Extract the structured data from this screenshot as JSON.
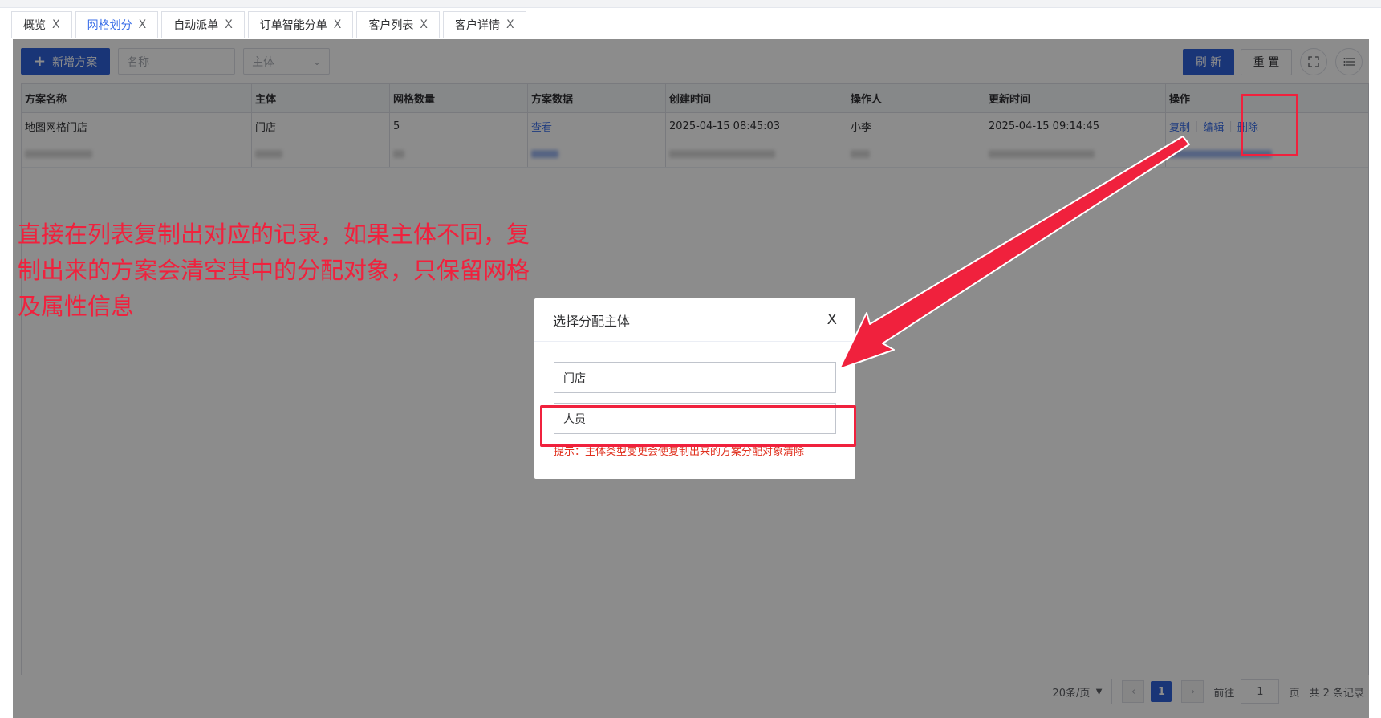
{
  "tabs": [
    {
      "label": "概览",
      "active": false
    },
    {
      "label": "网格划分",
      "active": true
    },
    {
      "label": "自动派单",
      "active": false
    },
    {
      "label": "订单智能分单",
      "active": false
    },
    {
      "label": "客户列表",
      "active": false
    },
    {
      "label": "客户详情",
      "active": false
    }
  ],
  "tab_close_glyph": "X",
  "toolbar": {
    "add_label": "新增方案",
    "name_placeholder": "名称",
    "subject_placeholder": "主体",
    "refresh_label": "刷 新",
    "reset_label": "重 置",
    "fullscreen_icon": "fullscreen-icon",
    "columns_icon": "list-settings-icon"
  },
  "table": {
    "headers": [
      "方案名称",
      "主体",
      "网格数量",
      "方案数据",
      "创建时间",
      "操作人",
      "更新时间",
      "操作"
    ],
    "rows": [
      {
        "name": "地图网格门店",
        "subject": "门店",
        "grid_count": "5",
        "data_link": "查看",
        "created": "2025-04-15 08:45:03",
        "operator": "小李",
        "updated": "2025-04-15 09:14:45",
        "actions": [
          "复制",
          "编辑",
          "删除"
        ]
      }
    ]
  },
  "pagination": {
    "page_size": "20条/页",
    "current_page": "1",
    "goto_label": "前往",
    "goto_value": "1",
    "page_suffix": "页",
    "total": "共 2 条记录"
  },
  "dialog": {
    "title": "选择分配主体",
    "close_glyph": "X",
    "field1_value": "门店",
    "field2_value": "人员",
    "tip": "提示：主体类型变更会使复制出来的方案分配对象清除"
  },
  "annotation": {
    "text": "直接在列表复制出对应的记录，如果主体不同，复制出来的方案会清空其中的分配对象，只保留网格及属性信息"
  },
  "colors": {
    "primary": "#2f62d9",
    "annotation_red": "#f0213d",
    "tip_red": "#e0301e"
  }
}
